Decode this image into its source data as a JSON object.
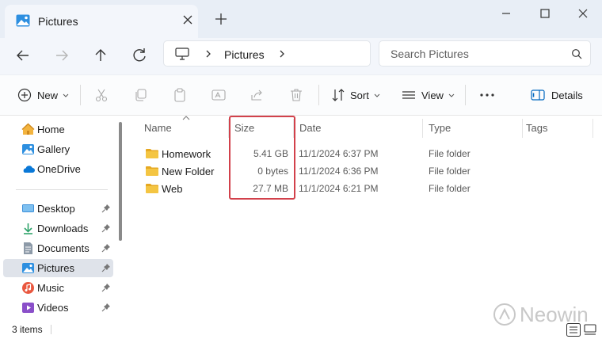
{
  "tab": {
    "title": "Pictures",
    "icon": "pictures-icon"
  },
  "window_controls": [
    "minimize-icon",
    "maximize-icon",
    "close-icon"
  ],
  "address": {
    "crumb": "Pictures"
  },
  "search": {
    "placeholder": "Search Pictures"
  },
  "toolbar": {
    "new_label": "New",
    "sort_label": "Sort",
    "view_label": "View",
    "details_label": "Details"
  },
  "sidebar": {
    "items": [
      {
        "label": "Home",
        "icon": "home-icon"
      },
      {
        "label": "Gallery",
        "icon": "gallery-icon"
      },
      {
        "label": "OneDrive",
        "icon": "onedrive-icon"
      },
      {
        "label": "Desktop",
        "icon": "desktop-icon",
        "pinned": true
      },
      {
        "label": "Downloads",
        "icon": "downloads-icon",
        "pinned": true
      },
      {
        "label": "Documents",
        "icon": "documents-icon",
        "pinned": true
      },
      {
        "label": "Pictures",
        "icon": "pictures-icon",
        "pinned": true,
        "selected": true
      },
      {
        "label": "Music",
        "icon": "music-icon",
        "pinned": true
      },
      {
        "label": "Videos",
        "icon": "videos-icon",
        "pinned": true
      }
    ]
  },
  "columns": {
    "name": "Name",
    "size": "Size",
    "date": "Date",
    "type": "Type",
    "tags": "Tags"
  },
  "files": [
    {
      "name": "Homework",
      "size": "5.41 GB",
      "date": "11/1/2024 6:37 PM",
      "type": "File folder"
    },
    {
      "name": "New Folder",
      "size": "0 bytes",
      "date": "11/1/2024 6:36 PM",
      "type": "File folder"
    },
    {
      "name": "Web",
      "size": "27.7 MB",
      "date": "11/1/2024 6:21 PM",
      "type": "File folder"
    }
  ],
  "status": {
    "item_count": "3 items"
  },
  "watermark": {
    "text": "Neowin"
  },
  "colors": {
    "highlight": "#d2414b",
    "folder": "#f4c542",
    "accent": "#0067c0"
  }
}
